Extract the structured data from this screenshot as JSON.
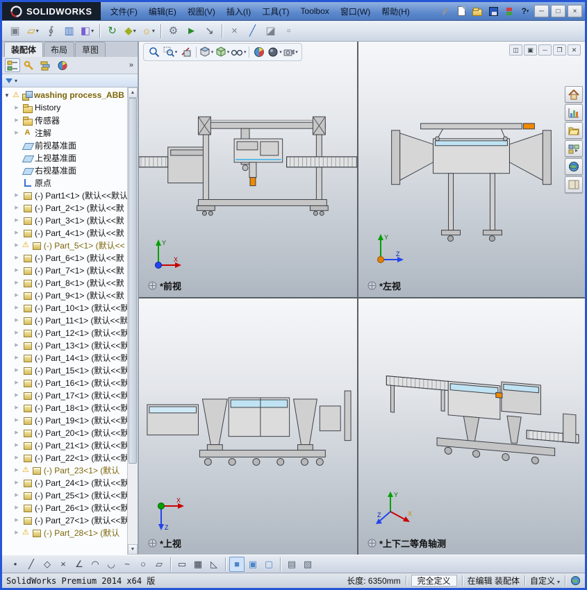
{
  "titlebar": {
    "brand": "SOLIDWORKS",
    "menus": [
      "文件(F)",
      "编辑(E)",
      "视图(V)",
      "插入(I)",
      "工具(T)",
      "Toolbox",
      "窗口(W)",
      "帮助(H)"
    ]
  },
  "window_controls": {
    "minimize": "─",
    "maximize": "□",
    "close": "×"
  },
  "main_toolbar": [
    {
      "icon": "component"
    },
    {
      "icon": "open-folder",
      "dropdown": true
    },
    {
      "icon": "paperclip"
    },
    {
      "icon": "design-table"
    },
    {
      "icon": "equations",
      "dropdown": true
    },
    {
      "icon": "sep"
    },
    {
      "icon": "rebuild"
    },
    {
      "icon": "insert-component",
      "dropdown": true
    },
    {
      "icon": "appearance",
      "dropdown": true
    },
    {
      "icon": "sep"
    },
    {
      "icon": "gears"
    },
    {
      "icon": "move"
    },
    {
      "icon": "smart"
    },
    {
      "icon": "sep"
    },
    {
      "icon": "delete"
    },
    {
      "icon": "measure"
    },
    {
      "icon": "section"
    },
    {
      "icon": "explode"
    }
  ],
  "panel": {
    "tabs": [
      {
        "label": "装配体",
        "active": true
      },
      {
        "label": "布局",
        "active": false
      },
      {
        "label": "草图",
        "active": false
      }
    ],
    "overflow": "»"
  },
  "tree": {
    "root": {
      "label": "washing process_ABB rob"
    },
    "items": [
      {
        "icon": "history",
        "label": "History",
        "expand": true
      },
      {
        "icon": "folder",
        "label": "传感器",
        "expand": true
      },
      {
        "icon": "annotations",
        "label": "注解",
        "expand": true
      },
      {
        "icon": "plane",
        "label": "前视基准面"
      },
      {
        "icon": "plane",
        "label": "上视基准面"
      },
      {
        "icon": "plane",
        "label": "右视基准面"
      },
      {
        "icon": "origin",
        "label": "原点"
      },
      {
        "icon": "part",
        "label": "(-) Part1<1> (默认<<默认",
        "expand": true
      },
      {
        "icon": "part",
        "label": "(-) Part_2<1> (默认<<默",
        "expand": true
      },
      {
        "icon": "part",
        "label": "(-) Part_3<1> (默认<<默",
        "expand": true
      },
      {
        "icon": "part",
        "label": "(-) Part_4<1> (默认<<默",
        "expand": true
      },
      {
        "icon": "part",
        "label": "(-) Part_5<1> (默认<<",
        "expand": true,
        "warn": true
      },
      {
        "icon": "part",
        "label": "(-) Part_6<1> (默认<<默",
        "expand": true
      },
      {
        "icon": "part",
        "label": "(-) Part_7<1> (默认<<默",
        "expand": true
      },
      {
        "icon": "part",
        "label": "(-) Part_8<1> (默认<<默",
        "expand": true
      },
      {
        "icon": "part",
        "label": "(-) Part_9<1> (默认<<默",
        "expand": true
      },
      {
        "icon": "part",
        "label": "(-) Part_10<1> (默认<<默",
        "expand": true
      },
      {
        "icon": "part",
        "label": "(-) Part_11<1> (默认<<默",
        "expand": true
      },
      {
        "icon": "part",
        "label": "(-) Part_12<1> (默认<<默",
        "expand": true
      },
      {
        "icon": "part",
        "label": "(-) Part_13<1> (默认<<默",
        "expand": true
      },
      {
        "icon": "part",
        "label": "(-) Part_14<1> (默认<<默",
        "expand": true
      },
      {
        "icon": "part",
        "label": "(-) Part_15<1> (默认<<默",
        "expand": true
      },
      {
        "icon": "part",
        "label": "(-) Part_16<1> (默认<<默",
        "expand": true
      },
      {
        "icon": "part",
        "label": "(-) Part_17<1> (默认<<默",
        "expand": true
      },
      {
        "icon": "part",
        "label": "(-) Part_18<1> (默认<<默",
        "expand": true
      },
      {
        "icon": "part",
        "label": "(-) Part_19<1> (默认<<默",
        "expand": true
      },
      {
        "icon": "part",
        "label": "(-) Part_20<1> (默认<<默",
        "expand": true
      },
      {
        "icon": "part",
        "label": "(-) Part_21<1> (默认<<默",
        "expand": true
      },
      {
        "icon": "part",
        "label": "(-) Part_22<1> (默认<<默",
        "expand": true
      },
      {
        "icon": "part",
        "label": "(-) Part_23<1> (默认",
        "expand": true,
        "warn": true
      },
      {
        "icon": "part",
        "label": "(-) Part_24<1> (默认<<默",
        "expand": true
      },
      {
        "icon": "part",
        "label": "(-) Part_25<1> (默认<<默",
        "expand": true
      },
      {
        "icon": "part",
        "label": "(-) Part_26<1> (默认<<默",
        "expand": true
      },
      {
        "icon": "part",
        "label": "(-) Part_27<1> (默认<<默",
        "expand": true
      },
      {
        "icon": "part",
        "label": "(-) Part_28<1> (默认",
        "expand": true,
        "warn": true
      }
    ]
  },
  "viewports": [
    {
      "label": "*前视"
    },
    {
      "label": "*左视"
    },
    {
      "label": "*上视"
    },
    {
      "label": "*上下二等角轴测"
    }
  ],
  "sketch_toolbar": [
    {
      "icon": "point"
    },
    {
      "icon": "line"
    },
    {
      "icon": "polygon"
    },
    {
      "icon": "erase"
    },
    {
      "icon": "angle"
    },
    {
      "icon": "arc"
    },
    {
      "icon": "arc2"
    },
    {
      "icon": "spline"
    },
    {
      "icon": "circle"
    },
    {
      "icon": "para"
    },
    {
      "icon": "sep"
    },
    {
      "icon": "rect"
    },
    {
      "icon": "grid"
    },
    {
      "icon": "tri"
    },
    {
      "icon": "sep"
    },
    {
      "icon": "shaded",
      "pressed": true
    },
    {
      "icon": "shaded-edges"
    },
    {
      "icon": "wireframe"
    },
    {
      "icon": "sep"
    },
    {
      "icon": "hlr"
    },
    {
      "icon": "hlv"
    }
  ],
  "statusbar": {
    "app": "SolidWorks Premium 2014 x64 版",
    "length": "长度:  6350mm",
    "state": "完全定义",
    "editing": "在编辑  装配体",
    "custom": "自定义"
  },
  "colors": {
    "window_border": "#2456d6",
    "viewport_top": "#f6f7f9",
    "viewport_bottom": "#aeb7c1",
    "warning_text": "#7d6608",
    "model_orange": "#f08a00",
    "model_blue": "#bfe3f2",
    "axis_x": "#cc0000",
    "axis_y": "#00a000",
    "axis_z": "#2244ee"
  }
}
